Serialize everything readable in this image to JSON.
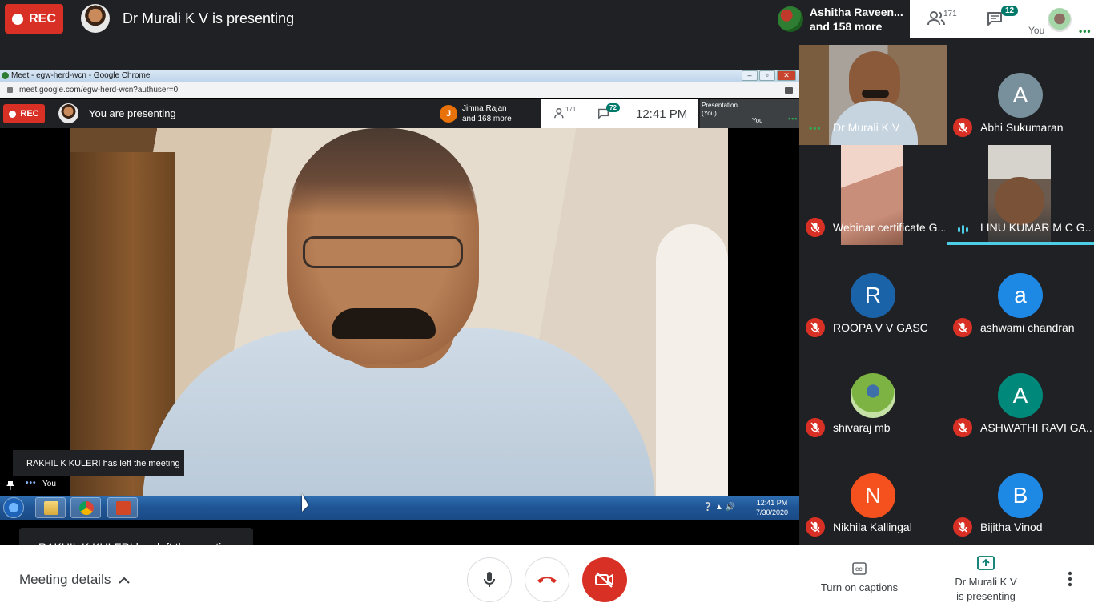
{
  "top": {
    "rec": "REC",
    "presenter_title": "Dr Murali K V is presenting",
    "attendees_name": "Ashitha Raveen...",
    "attendees_more": "and 158 more",
    "people_count": "171",
    "chat_count": "12",
    "you_label": "You"
  },
  "shared_screen": {
    "chrome_title": "Meet - egw-herd-wcn - Google Chrome",
    "url": "meet.google.com/egw-herd-wcn?authuser=0",
    "rec": "REC",
    "presenting_text": "You are presenting",
    "attendee_initial": "J",
    "attendee_name": "Jimna Rajan",
    "attendee_more": "and 168 more",
    "people_count": "171",
    "chat_count": "72",
    "time": "12:41  PM",
    "presentation_label": "Presentation\n(You)",
    "you_label": "You",
    "toast": "RAKHIL K KULERI has left the meeting",
    "bottom_you": "You",
    "taskbar_time": "12:41 PM",
    "taskbar_date": "7/30/2020"
  },
  "tiles": [
    {
      "name": "Dr Murali K V",
      "kind": "photo",
      "status": "dots"
    },
    {
      "name": "Abhi Sukumaran",
      "kind": "initial",
      "initial": "A",
      "color": "#78909c",
      "status": "muted"
    },
    {
      "name": "Webinar certificate G...",
      "kind": "photo",
      "status": "muted"
    },
    {
      "name": "LINU KUMAR M C G...",
      "kind": "photo",
      "status": "speaking"
    },
    {
      "name": "ROOPA V V GASC",
      "kind": "initial",
      "initial": "R",
      "color": "#1a63a8",
      "status": "muted"
    },
    {
      "name": "ashwami chandran",
      "kind": "initial",
      "initial": "a",
      "color": "#1e88e5",
      "status": "muted"
    },
    {
      "name": "shivaraj mb",
      "kind": "photo",
      "status": "muted"
    },
    {
      "name": "ASHWATHI RAVI GA...",
      "kind": "initial",
      "initial": "A",
      "color": "#00897b",
      "status": "muted"
    },
    {
      "name": "Nikhila Kallingal",
      "kind": "initial",
      "initial": "N",
      "color": "#f4511e",
      "status": "muted"
    },
    {
      "name": "Bijitha Vinod",
      "kind": "initial",
      "initial": "B",
      "color": "#1e88e5",
      "status": "muted"
    }
  ],
  "toast": "RAKHIL K KULERI has left the meeting",
  "bottom": {
    "meeting_details": "Meeting details",
    "captions": "Turn on captions",
    "presenting_line1": "Dr Murali K V",
    "presenting_line2": "is presenting"
  },
  "colors": {
    "rec_red": "#d93025",
    "badge_teal": "#00796b",
    "speaking_cyan": "#4ecde6",
    "dark_bg": "#202124"
  }
}
